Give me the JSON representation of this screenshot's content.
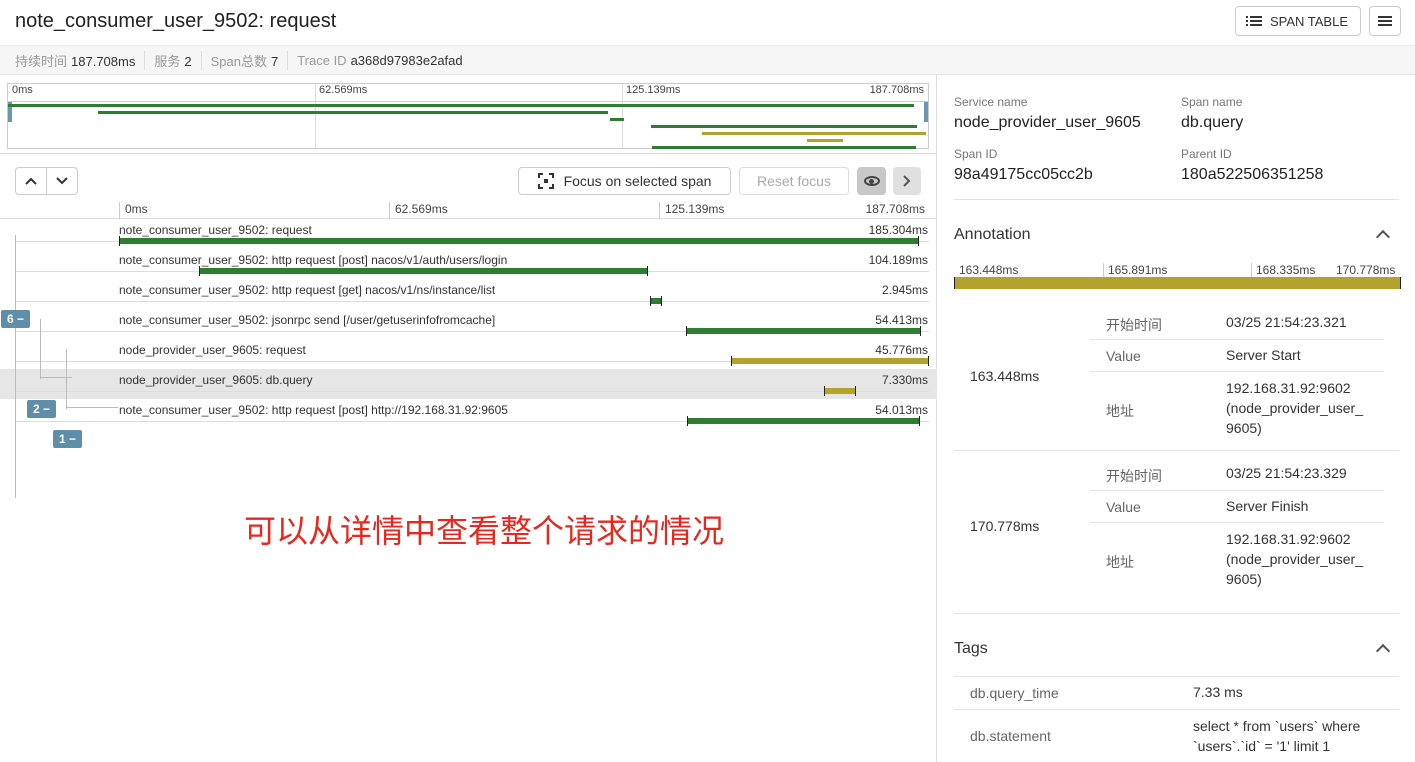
{
  "header": {
    "title": "note_consumer_user_9502: request",
    "span_table_label": "SPAN TABLE"
  },
  "meta": {
    "duration_label": "持续时间",
    "duration": "187.708ms",
    "services_label": "服务",
    "services": "2",
    "span_count_label": "Span总数",
    "span_count": "7",
    "trace_id_label": "Trace ID",
    "trace_id": "a368d97983e2afad"
  },
  "ticks": [
    "0ms",
    "62.569ms",
    "125.139ms",
    "187.708ms"
  ],
  "controls": {
    "up": "^",
    "down": "v",
    "focus_label": "Focus on selected span",
    "reset_label": "Reset focus",
    "next": ">"
  },
  "spans": [
    {
      "name": "note_consumer_user_9502: request",
      "duration": "185.304ms",
      "start_ms": 0,
      "end_ms": 185.304,
      "service": "consumer"
    },
    {
      "name": "note_consumer_user_9502: http request [post] nacos/v1/auth/users/login",
      "duration": "104.189ms",
      "start_ms": 18.5,
      "end_ms": 122.7,
      "service": "consumer"
    },
    {
      "name": "note_consumer_user_9502: http request [get] nacos/v1/ns/instance/list",
      "duration": "2.945ms",
      "start_ms": 123.0,
      "end_ms": 125.9,
      "service": "consumer"
    },
    {
      "name": "note_consumer_user_9502: jsonrpc send [/user/getuserinfofromcache]",
      "duration": "54.413ms",
      "start_ms": 131.5,
      "end_ms": 185.9,
      "service": "consumer"
    },
    {
      "name": "node_provider_user_9605: request",
      "duration": "45.776ms",
      "start_ms": 141.9,
      "end_ms": 187.7,
      "service": "provider"
    },
    {
      "name": "node_provider_user_9605: db.query",
      "duration": "7.330ms",
      "start_ms": 163.4,
      "end_ms": 170.8,
      "service": "provider",
      "selected": true
    },
    {
      "name": "note_consumer_user_9502: http request [post] http://192.168.31.92:9605",
      "duration": "54.013ms",
      "start_ms": 131.7,
      "end_ms": 185.7,
      "service": "consumer"
    }
  ],
  "badges": [
    "6 −",
    "2 −",
    "1 −"
  ],
  "overlay_note": "可以从详情中查看整个请求的情况",
  "detail": {
    "service_name_label": "Service name",
    "service_name": "node_provider_user_9605",
    "span_name_label": "Span name",
    "span_name": "db.query",
    "span_id_label": "Span ID",
    "span_id": "98a49175cc05cc2b",
    "parent_id_label": "Parent ID",
    "parent_id": "180a522506351258"
  },
  "annotation": {
    "title": "Annotation",
    "ticks": [
      "163.448ms",
      "165.891ms",
      "168.335ms",
      "170.778ms"
    ],
    "events": [
      {
        "time": "163.448ms",
        "start_label": "开始时间",
        "start": "03/25 21:54:23.321",
        "value_label": "Value",
        "value": "Server Start",
        "addr_label": "地址",
        "addr_1": "192.168.31.92:9602",
        "addr_2": "(node_provider_user_",
        "addr_3": "9605)"
      },
      {
        "time": "170.778ms",
        "start_label": "开始时间",
        "start": "03/25 21:54:23.329",
        "value_label": "Value",
        "value": "Server Finish",
        "addr_label": "地址",
        "addr_1": "192.168.31.92:9602",
        "addr_2": "(node_provider_user_",
        "addr_3": "9605)"
      }
    ]
  },
  "tags": {
    "title": "Tags",
    "items": [
      {
        "key": "db.query_time",
        "value_1": "7.33 ms",
        "value_2": ""
      },
      {
        "key": "db.statement",
        "value_1": "select * from `users` where",
        "value_2": "`users`.`id` = '1' limit 1"
      }
    ]
  },
  "colors": {
    "consumer": "#2e7d32",
    "provider": "#b3a22b",
    "badge": "#5f8fa8",
    "note": "#e8281f"
  }
}
